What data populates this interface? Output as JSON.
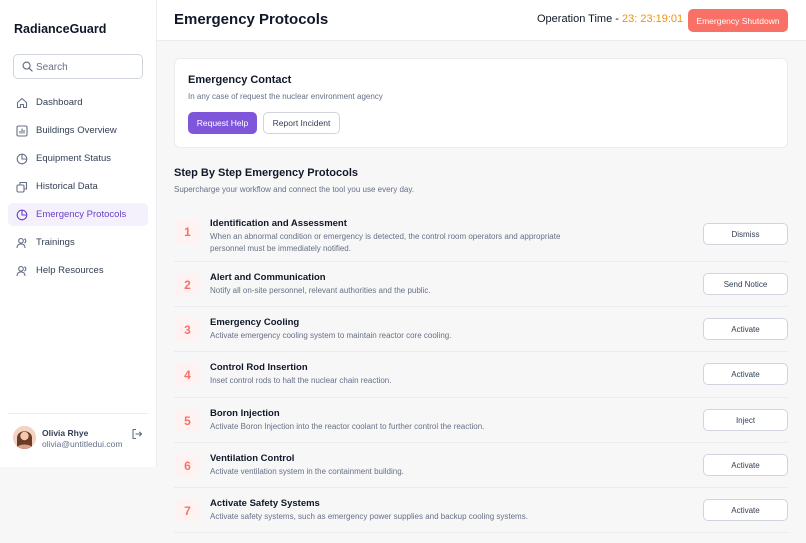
{
  "app": {
    "name": "RadianceGuard"
  },
  "search": {
    "placeholder": "Search"
  },
  "sidebar": {
    "items": [
      {
        "label": "Dashboard",
        "icon": "home-icon"
      },
      {
        "label": "Buildings Overview",
        "icon": "bar-chart-icon"
      },
      {
        "label": "Equipment Status",
        "icon": "pie-chart-icon"
      },
      {
        "label": "Historical Data",
        "icon": "layers-icon"
      },
      {
        "label": "Emergency Protocols",
        "icon": "pie-chart-icon",
        "active": true
      },
      {
        "label": "Trainings",
        "icon": "users-icon"
      },
      {
        "label": "Help Resources",
        "icon": "users-icon"
      }
    ]
  },
  "user": {
    "name": "Olivia Rhye",
    "email": "olivia@untitledui.com"
  },
  "header": {
    "title": "Emergency Protocols",
    "operation_label": "Operation Time - ",
    "operation_time": "23: 23:19:01",
    "shutdown_label": "Emergency Shutdown"
  },
  "contact": {
    "title": "Emergency Contact",
    "subtitle": "In any case of request the nuclear environment agency",
    "primary_label": "Request Help",
    "secondary_label": "Report Incident"
  },
  "protocols": {
    "title": "Step By Step Emergency Protocols",
    "subtitle": "Supercharge your workflow and connect the tool you use every day.",
    "steps": [
      {
        "num": "1",
        "title": "Identification and Assessment",
        "desc": "When an abnormal condition or emergency is detected, the control room operators and appropriate personnel must be immediately notified.",
        "action": "Dismiss"
      },
      {
        "num": "2",
        "title": "Alert and Communication",
        "desc": "Notify all on-site personnel, relevant authorities and the public.",
        "action": "Send Notice"
      },
      {
        "num": "3",
        "title": "Emergency Cooling",
        "desc": "Activate emergency cooling system to maintain reactor core cooling.",
        "action": "Activate"
      },
      {
        "num": "4",
        "title": "Control Rod Insertion",
        "desc": "Inset control rods to halt the nuclear chain reaction.",
        "action": "Activate"
      },
      {
        "num": "5",
        "title": "Boron Injection",
        "desc": "Activate Boron Injection into the reactor coolant to further control the reaction.",
        "action": "Inject"
      },
      {
        "num": "6",
        "title": "Ventilation Control",
        "desc": "Activate ventilation system in the containment building.",
        "action": "Activate"
      },
      {
        "num": "7",
        "title": "Activate Safety Systems",
        "desc": "Activate safety systems, such as emergency power supplies and backup cooling systems.",
        "action": "Activate"
      }
    ]
  },
  "colors": {
    "accent": "#7f56d9",
    "danger": "#f97066",
    "clock": "#f79009",
    "active_nav_bg": "#f4f1fd"
  }
}
